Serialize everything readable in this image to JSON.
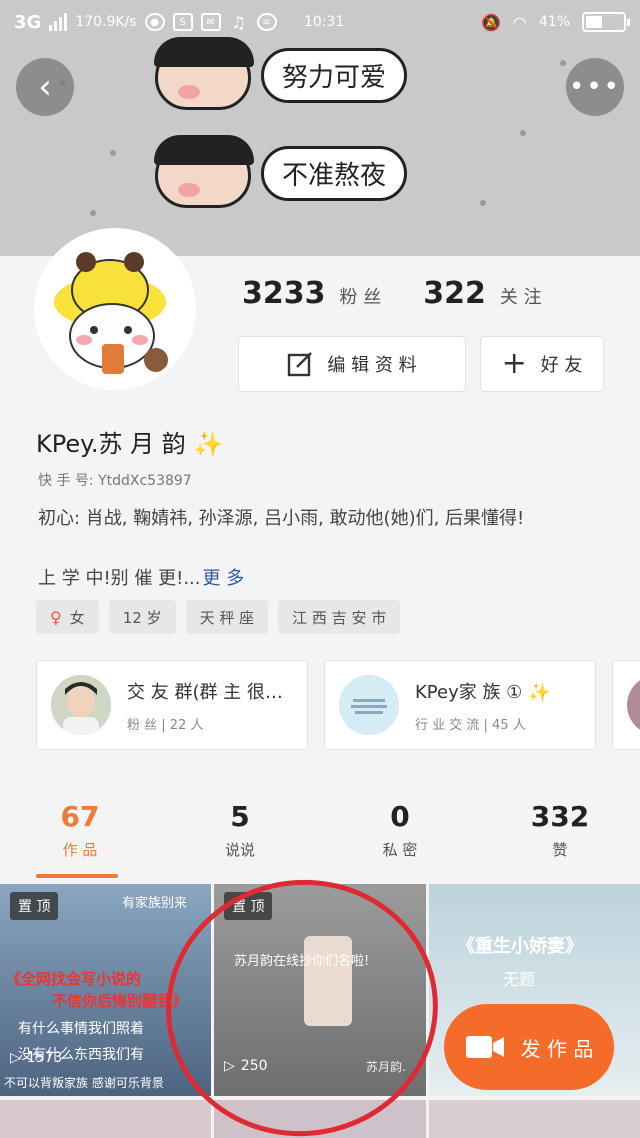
{
  "status_bar": {
    "network": "3G",
    "speed": "170.9K/s",
    "time": "10:31",
    "battery": "41%"
  },
  "cover": {
    "sticker1": "努力可爱",
    "sticker2": "不准熬夜"
  },
  "stats": {
    "followers_count": "3233",
    "followers_label": "粉 丝",
    "following_count": "322",
    "following_label": "关 注"
  },
  "buttons": {
    "edit_profile": "编 辑 资 料",
    "add_friend": "好 友"
  },
  "profile": {
    "name": "KPey.苏 月 韵",
    "uid": "快 手 号: YtddXc53897",
    "bio_line1": "初心: 肖战, 鞠婧祎, 孙泽源, 吕小雨, 敢动他(她)们, 后果懂得!",
    "bio_line2": "上 学 中!别 催 更!...",
    "more": "更 多"
  },
  "tags": [
    "女",
    "12 岁",
    "天 秤 座",
    "江 西  吉 安 市"
  ],
  "groups": [
    {
      "title": "交 友 群(群 主 很…",
      "sub": "粉 丝 | 22 人"
    },
    {
      "title": "KPey家 族 ①",
      "sub": "行 业 交 流 | 45 人"
    }
  ],
  "tabs": [
    {
      "count": "67",
      "label": "作 品"
    },
    {
      "count": "5",
      "label": "说说"
    },
    {
      "count": "0",
      "label": "私 密"
    },
    {
      "count": "332",
      "label": "赞"
    }
  ],
  "grid": {
    "item1": {
      "pin": "置 顶",
      "headline": "《全网找会写小说的",
      "headline2": "不信你后悔别翻我》",
      "caption1": "有什么事情我们照着",
      "caption2": "没有什么东西我们有",
      "caption3": "不可以背叛家族 感谢可乐背景",
      "plays": "1573",
      "top_right": "有家族别来"
    },
    "item2": {
      "pin": "置 顶",
      "overlay": "苏月韵在线抄你们名啦!",
      "plays": "250",
      "watermark": "苏月韵."
    },
    "item3": {
      "title": "《重生小娇妻》",
      "sub": "无题"
    }
  },
  "fab": {
    "label": "发 作 品"
  }
}
